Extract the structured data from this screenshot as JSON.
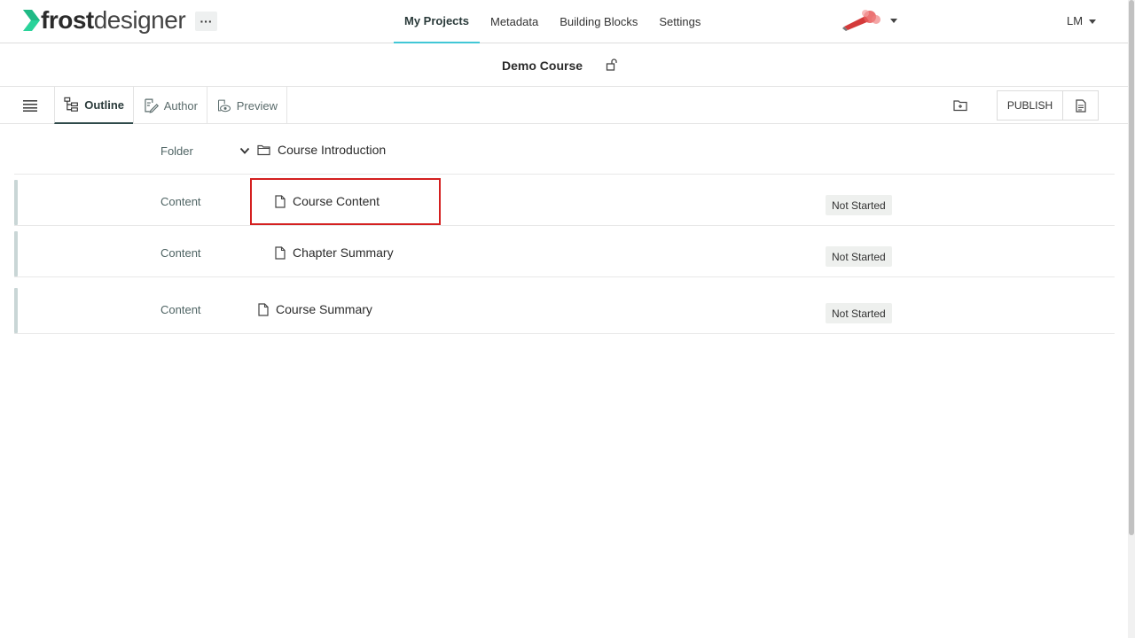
{
  "app": {
    "logo_bold": "frost",
    "logo_light": "designer",
    "more_label": "···"
  },
  "nav": {
    "items": [
      {
        "label": "My Projects",
        "active": true
      },
      {
        "label": "Metadata",
        "active": false
      },
      {
        "label": "Building Blocks",
        "active": false
      },
      {
        "label": "Settings",
        "active": false
      }
    ],
    "user_initials": "LM"
  },
  "course": {
    "title": "Demo Course"
  },
  "toolbar": {
    "tabs": [
      {
        "label": "Outline",
        "active": true
      },
      {
        "label": "Author",
        "active": false
      },
      {
        "label": "Preview",
        "active": false
      }
    ],
    "publish_label": "PUBLISH"
  },
  "outline": {
    "rows": [
      {
        "type": "Folder",
        "name": "Course Introduction",
        "status": ""
      },
      {
        "type": "Content",
        "name": "Course Content",
        "status": "Not Started"
      },
      {
        "type": "Content",
        "name": "Chapter Summary",
        "status": "Not Started"
      },
      {
        "type": "Content",
        "name": "Course Summary",
        "status": "Not Started"
      }
    ]
  },
  "colors": {
    "accent": "#41c7d6",
    "logo_green": "#2ad39a",
    "highlight": "#d42020"
  }
}
